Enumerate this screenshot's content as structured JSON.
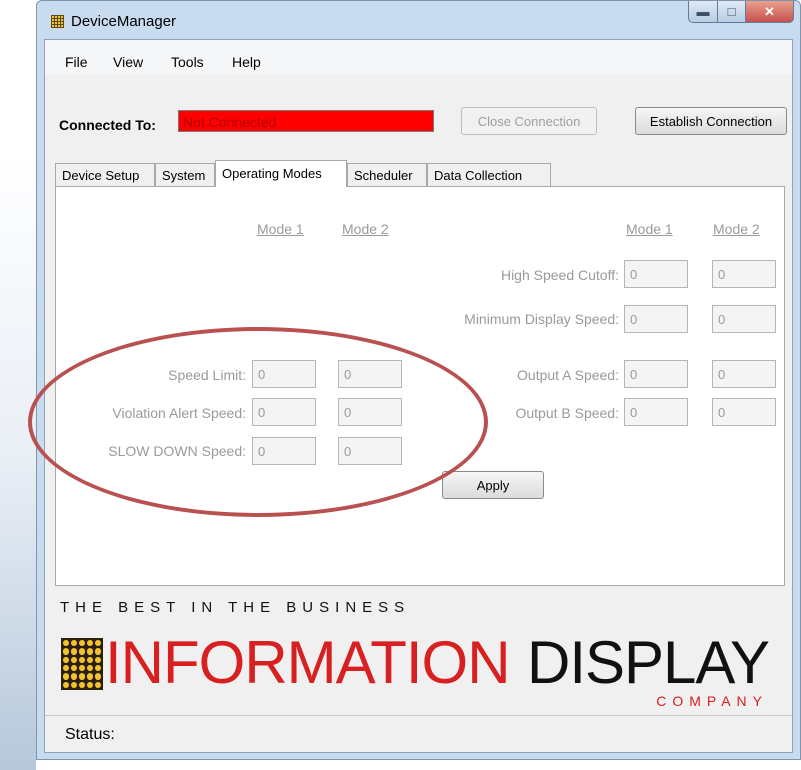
{
  "window": {
    "title": "DeviceManager"
  },
  "menu": [
    "File",
    "View",
    "Tools",
    "Help"
  ],
  "connection": {
    "label": "Connected To:",
    "value": "Not Connected",
    "close_label": "Close Connection",
    "establish_label": "Establish Connection"
  },
  "tabs": [
    "Device Setup",
    "System",
    "Operating Modes",
    "Scheduler",
    "Data Collection"
  ],
  "active_tab": "Operating Modes",
  "operating_modes": {
    "mode1_header": "Mode 1",
    "mode2_header": "Mode 2",
    "left_rows": [
      {
        "label": "Speed Limit:",
        "mode1": "0",
        "mode2": "0"
      },
      {
        "label": "Violation Alert Speed:",
        "mode1": "0",
        "mode2": "0"
      },
      {
        "label": "SLOW DOWN Speed:",
        "mode1": "0",
        "mode2": "0"
      }
    ],
    "right_rows": [
      {
        "label": "High Speed Cutoff:",
        "mode1": "0",
        "mode2": "0"
      },
      {
        "label": "Minimum Display Speed:",
        "mode1": "0",
        "mode2": "0"
      },
      {
        "label": "Output A Speed:",
        "mode1": "0",
        "mode2": "0"
      },
      {
        "label": "Output B Speed:",
        "mode1": "0",
        "mode2": "0"
      }
    ],
    "apply_label": "Apply"
  },
  "banner": {
    "tagline": "THE BEST IN THE BUSINESS",
    "brand_red": "INFORMATION",
    "brand_black": "DISPLAY",
    "company": "COMPANY"
  },
  "status": {
    "label": "Status:"
  },
  "colors": {
    "not_connected_bg": "#ff0000",
    "brand_red": "#d82020",
    "annotation_circle": "#b8514f"
  }
}
